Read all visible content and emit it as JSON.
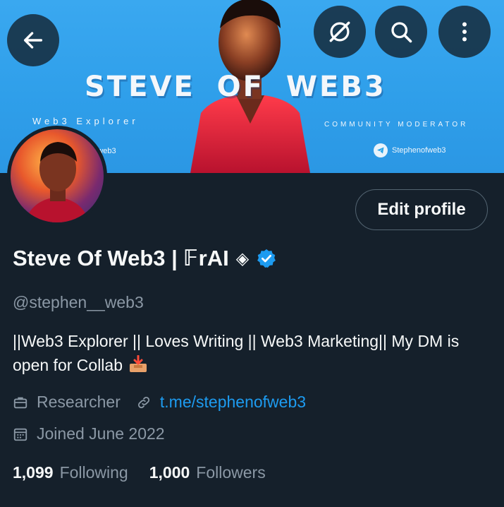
{
  "header": {
    "back_icon": "arrow-left-icon",
    "grok_icon": "grok-icon",
    "search_icon": "search-icon",
    "more_icon": "more-vertical-icon"
  },
  "banner": {
    "title_part1": "STEVE",
    "title_part2": "OF",
    "title_part3": "WEB3",
    "subtitle": "Web3 Explorer",
    "role": "COMMUNITY MODERATOR",
    "handle_text": "n__web3",
    "telegram_text": "Stephenofweb3",
    "bg_color": "#2f9fea"
  },
  "profile": {
    "edit_label": "Edit profile",
    "name": "Steve Of Web3 | 𝔽rAI",
    "name_symbol": "◈",
    "verified_color": "#1d9bf0",
    "handle": "@stephen__web3",
    "bio": "||Web3 Explorer || Loves Writing || Web3 Marketing|| My DM is open for Collab",
    "profession": "Researcher",
    "link": "t.me/stephenofweb3",
    "joined": "Joined June 2022",
    "following_count": "1,099",
    "following_label": "Following",
    "followers_count": "1,000",
    "followers_label": "Followers"
  },
  "colors": {
    "background": "#15202b",
    "muted_text": "#8b98a5",
    "accent": "#1d9bf0"
  }
}
